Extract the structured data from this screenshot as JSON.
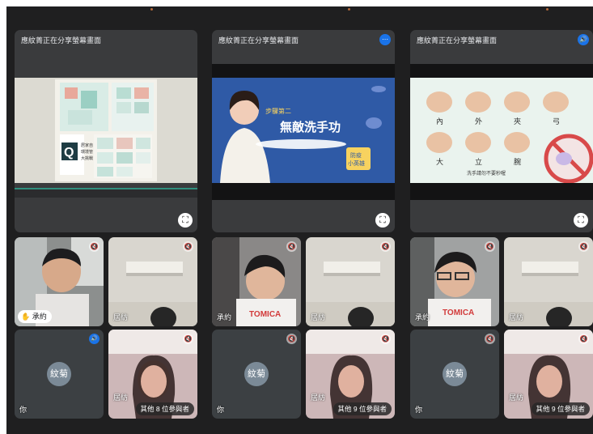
{
  "columns": [
    {
      "presenter_title": "應紋菁正在分享螢幕畫面",
      "presenter_icon": "",
      "slide_type": "booklet",
      "slide_text": {
        "q_letter": "Q",
        "caption_1": "居家自",
        "caption_2": "環境管",
        "caption_3": "大挑戰"
      },
      "fullscreen_icon": "⛶",
      "tiles": [
        {
          "name": "承約",
          "type": "boy",
          "mute": "🔇",
          "raised_hand": "✋"
        },
        {
          "name": "居紡",
          "type": "room",
          "mute": "🔇"
        },
        {
          "name": "你",
          "type": "avatar",
          "avatar_text": "紋菊",
          "speaking_icon": "🔊"
        },
        {
          "name": "居紡",
          "type": "girl",
          "mute": "🔇"
        }
      ],
      "others_label": "其他 8 位參與者"
    },
    {
      "presenter_title": "應紋菁正在分享螢幕畫面",
      "presenter_icon": "⋯",
      "slide_type": "teacher",
      "slide_text": {
        "line1": "步驟第二",
        "line2": "無敵洗手功",
        "line3": "防疫",
        "line4": "小英雄"
      },
      "fullscreen_icon": "⛶",
      "tiles": [
        {
          "name": "承約",
          "type": "boy",
          "mute": "🔇"
        },
        {
          "name": "居紡",
          "type": "room",
          "mute": "🔇"
        },
        {
          "name": "你",
          "type": "avatar",
          "avatar_text": "紋菊",
          "mute": "🔇"
        },
        {
          "name": "居紡",
          "type": "girl",
          "mute": "🔇"
        }
      ],
      "others_label": "其他 9 位參與者"
    },
    {
      "presenter_title": "應紋菁正在分享螢幕畫面",
      "presenter_icon": "🔊",
      "slide_type": "handwash",
      "slide_text": {
        "labels": [
          "內",
          "外",
          "夾",
          "弓",
          "大",
          "立",
          "腕"
        ],
        "note": "洗手請勿不要秒喔"
      },
      "fullscreen_icon": "⛶",
      "tiles": [
        {
          "name": "承約",
          "type": "boy",
          "mute": "🔇"
        },
        {
          "name": "居紡",
          "type": "room",
          "mute": "🔇"
        },
        {
          "name": "你",
          "type": "avatar",
          "avatar_text": "紋菊",
          "mute": "🔇"
        },
        {
          "name": "居紡",
          "type": "girl",
          "mute": "🔇"
        }
      ],
      "others_label": "其他 9 位參與者"
    }
  ],
  "colors": {
    "background": "#1f1f20",
    "tile": "#3c4043",
    "accent": "#1a73e8"
  }
}
